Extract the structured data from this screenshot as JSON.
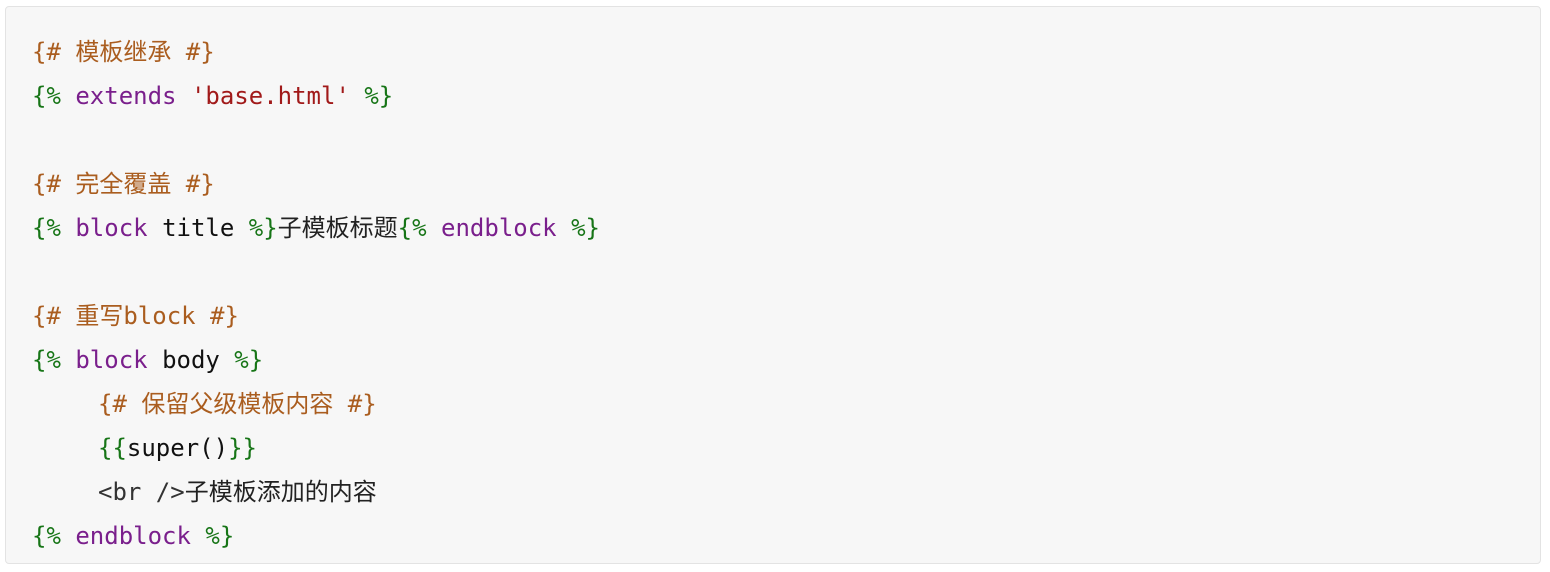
{
  "code_lines": [
    {
      "segments": {
        "s0": "{# 模板继承 #}"
      }
    },
    {
      "segments": {
        "s0": "{%",
        "s1": " extends ",
        "s2": "'base.html'",
        "s3": " %}"
      }
    },
    {
      "segments": {}
    },
    {
      "segments": {
        "s0": "{# 完全覆盖 #}"
      }
    },
    {
      "segments": {
        "s0": "{%",
        "s1": " block ",
        "s2": "title",
        "s3": " %}",
        "s4": "子模板标题",
        "s5": "{%",
        "s6": " endblock ",
        "s7": "%}"
      }
    },
    {
      "segments": {}
    },
    {
      "segments": {
        "s0": "{# 重写block #}"
      }
    },
    {
      "segments": {
        "s0": "{%",
        "s1": " block ",
        "s2": "body",
        "s3": " %}"
      }
    },
    {
      "segments": {
        "s0": "{# 保留父级模板内容 #}"
      }
    },
    {
      "segments": {
        "s0": "{{",
        "s1": "super()",
        "s2": "}}"
      }
    },
    {
      "segments": {
        "s0": "<br />",
        "s1": "子模板添加的内容"
      }
    },
    {
      "segments": {
        "s0": "{%",
        "s1": " endblock ",
        "s2": "%}"
      }
    }
  ],
  "colors": {
    "background": "#f7f7f7",
    "comment": "#aa5d1f",
    "template_tag": "#177517",
    "keyword": "#7a1f8c",
    "string": "#a11a1a",
    "plain": "#111111"
  }
}
